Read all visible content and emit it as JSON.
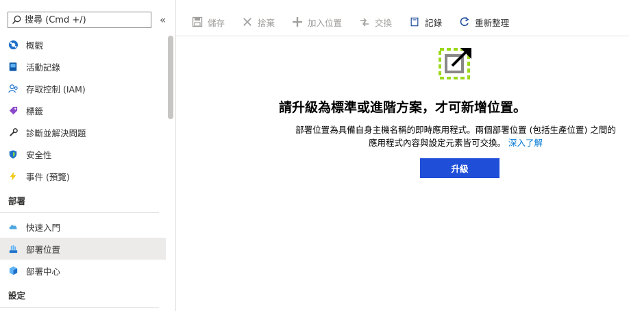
{
  "sidebar": {
    "search_placeholder": "搜尋 (Cmd +/)",
    "collapse": "«",
    "items": [
      {
        "label": "概觀",
        "icon": "overview-icon"
      },
      {
        "label": "活動記錄",
        "icon": "activity-log-icon"
      },
      {
        "label": "存取控制 (IAM)",
        "icon": "access-control-icon"
      },
      {
        "label": "標籤",
        "icon": "tag-icon"
      },
      {
        "label": "診斷並解決問題",
        "icon": "wrench-icon"
      },
      {
        "label": "安全性",
        "icon": "shield-icon"
      },
      {
        "label": "事件 (預覽)",
        "icon": "lightning-icon"
      }
    ],
    "section_deploy": "部署",
    "deploy_items": [
      {
        "label": "快速入門",
        "icon": "cloud-icon"
      },
      {
        "label": "部署位置",
        "icon": "deployment-slots-icon",
        "selected": true
      },
      {
        "label": "部署中心",
        "icon": "deployment-center-icon"
      }
    ],
    "section_settings": "設定"
  },
  "toolbar": {
    "save": "儲存",
    "discard": "捨棄",
    "add_slot": "加入位置",
    "swap": "交換",
    "logs": "記錄",
    "refresh": "重新整理"
  },
  "main": {
    "title": "請升級為標準或進階方案，才可新增位置。",
    "description": "部署位置為具備自身主機名稱的即時應用程式。兩個部署位置 (包括生產位置) 之間的應用程式內容與設定元素皆可交換。",
    "learn_more": "深入了解",
    "upgrade_button": "升級"
  },
  "colors": {
    "accent": "#0078d4",
    "upgrade_button": "#1f4ed8",
    "selected_bg": "#edebe9",
    "hero_dashed": "#9bd91a"
  }
}
